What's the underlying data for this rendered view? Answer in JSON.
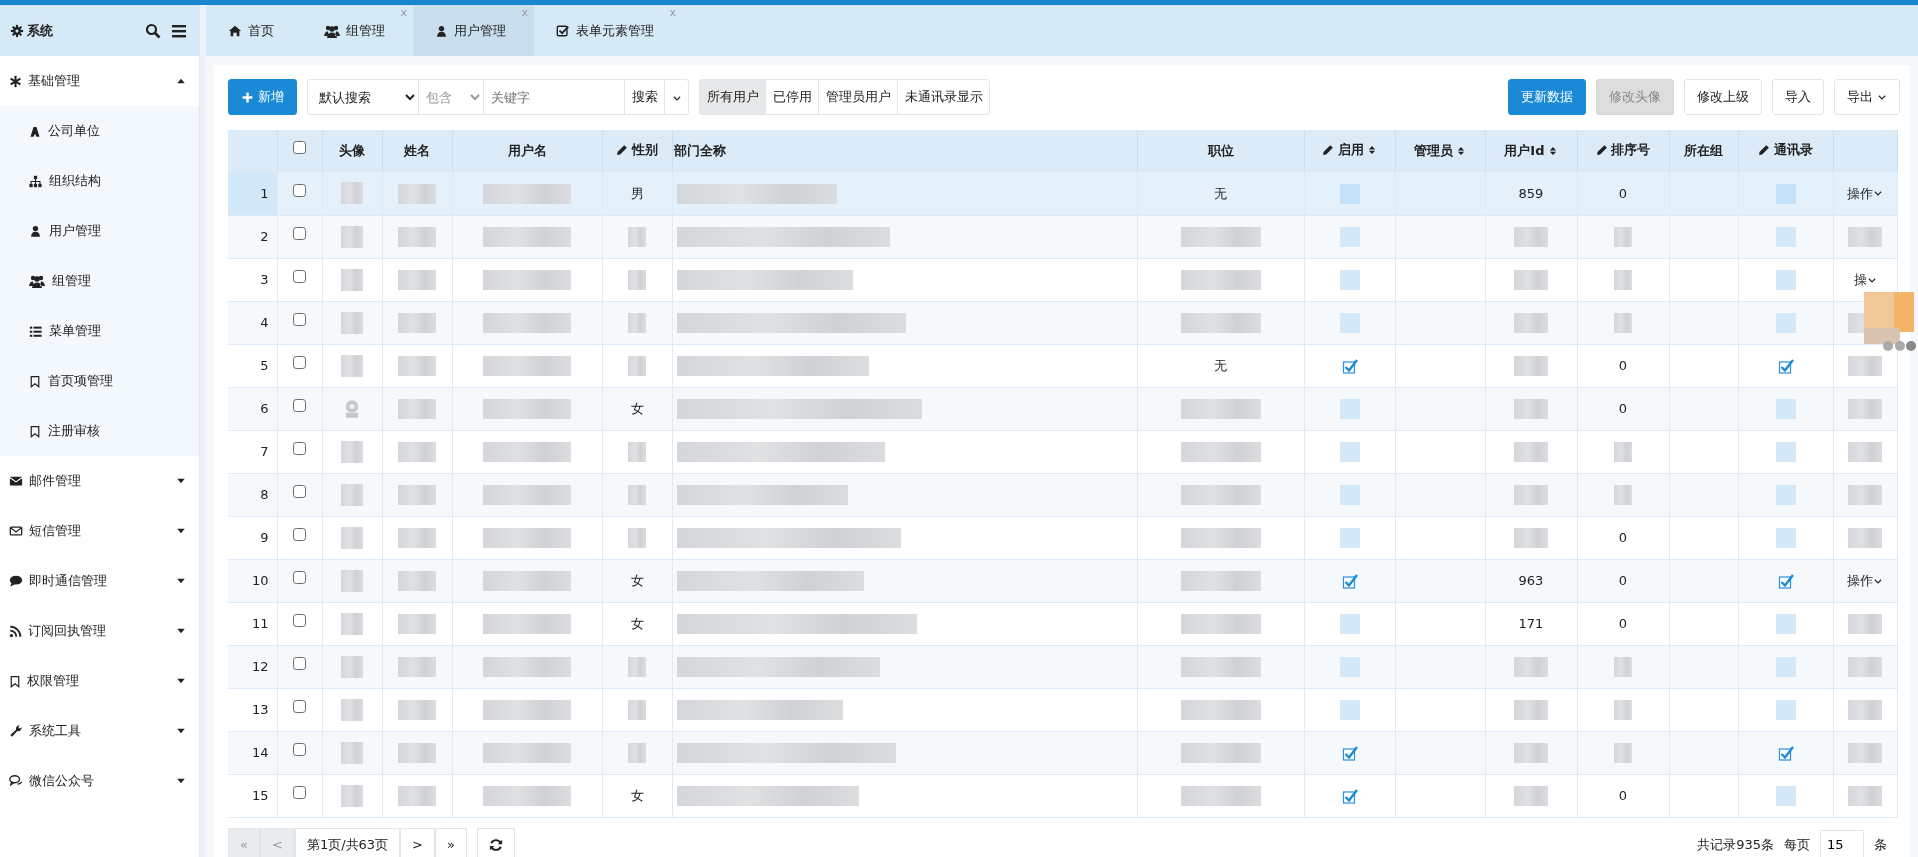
{
  "sidebar": {
    "title": "系统",
    "groups": [
      {
        "label": "基础管理",
        "expanded": true,
        "children": [
          {
            "label": "公司单位",
            "selected": false
          },
          {
            "label": "组织结构",
            "selected": false
          },
          {
            "label": "用户管理",
            "selected": false
          },
          {
            "label": "组管理",
            "selected": false
          },
          {
            "label": "菜单管理",
            "selected": false
          },
          {
            "label": "首页项管理",
            "selected": false
          },
          {
            "label": "注册审核",
            "selected": false
          }
        ]
      },
      {
        "label": "邮件管理",
        "expanded": false
      },
      {
        "label": "短信管理",
        "expanded": false
      },
      {
        "label": "即时通信管理",
        "expanded": false
      },
      {
        "label": "订阅回执管理",
        "expanded": false
      },
      {
        "label": "权限管理",
        "expanded": false
      },
      {
        "label": "系统工具",
        "expanded": false
      },
      {
        "label": "微信公众号",
        "expanded": false
      }
    ]
  },
  "tabs": [
    {
      "label": "首页",
      "selected": false
    },
    {
      "label": "组管理",
      "selected": false,
      "close": "x"
    },
    {
      "label": "用户管理",
      "selected": true,
      "close": "x"
    },
    {
      "label": "表单元素管理",
      "selected": false,
      "close": "x"
    }
  ],
  "toolbar": {
    "add": "新增",
    "search_mode": "默认搜索",
    "match": "包含",
    "keyword_placeholder": "关键字",
    "search": "搜索",
    "filters": [
      {
        "label": "所有用户",
        "selected": true
      },
      {
        "label": "已停用",
        "selected": false
      },
      {
        "label": "管理员用户",
        "selected": false
      },
      {
        "label": "未通讯录显示",
        "selected": false
      }
    ],
    "actions": [
      {
        "label": "更新数据",
        "kind": "primary",
        "disabled": false
      },
      {
        "label": "修改头像",
        "kind": "plain",
        "disabled": true
      },
      {
        "label": "修改上级",
        "kind": "plain",
        "disabled": false
      },
      {
        "label": "导入",
        "kind": "plain",
        "disabled": false
      },
      {
        "label": "导出",
        "kind": "dropdown",
        "disabled": false
      }
    ]
  },
  "table": {
    "all_checked": false,
    "columns": [
      {},
      {},
      {
        "label": "头像"
      },
      {
        "label": "姓名"
      },
      {
        "label": "用户名"
      },
      {
        "label": "性别",
        "editable": true,
        "sortable": false
      },
      {
        "label": "部门全称"
      },
      {
        "label": "职位"
      },
      {
        "label": "启用",
        "editable": true,
        "sortable": true
      },
      {
        "label": "管理员",
        "editable": false,
        "sortable": true
      },
      {
        "label": "用户Id",
        "editable": false,
        "sortable": true
      },
      {
        "label": "排序号",
        "editable": true,
        "sortable": false
      },
      {
        "label": "所在组"
      },
      {
        "label": "通讯录",
        "editable": true,
        "sortable": false
      },
      {}
    ],
    "rows": [
      {
        "no": "1",
        "selected": true,
        "checked": false,
        "avatar": {
          "kind": "blurred"
        },
        "name": null,
        "username": null,
        "gender": "男",
        "dept": null,
        "position": "无",
        "enabled": null,
        "userid": "859",
        "sort": "0",
        "contacts": null,
        "op": "操作"
      },
      {
        "no": "2",
        "selected": false,
        "checked": false,
        "avatar": {
          "kind": "blurred"
        },
        "name": null,
        "username": null,
        "gender": null,
        "dept": null,
        "position": null,
        "enabled": null,
        "userid": null,
        "sort": null,
        "contacts": null,
        "op": null
      },
      {
        "no": "3",
        "selected": false,
        "checked": false,
        "avatar": {
          "kind": "blurred"
        },
        "name": null,
        "username": null,
        "gender": null,
        "dept": null,
        "position": null,
        "enabled": null,
        "userid": null,
        "sort": null,
        "contacts": null,
        "op": "操"
      },
      {
        "no": "4",
        "selected": false,
        "checked": false,
        "avatar": {
          "kind": "blurred"
        },
        "name": null,
        "username": null,
        "gender": null,
        "dept": null,
        "position": null,
        "enabled": null,
        "userid": null,
        "sort": null,
        "contacts": null,
        "op": null
      },
      {
        "no": "5",
        "selected": false,
        "checked": false,
        "avatar": {
          "kind": "blurred"
        },
        "name": null,
        "username": null,
        "gender": null,
        "dept": null,
        "position": "无",
        "enabled": true,
        "userid": null,
        "sort": "0",
        "contacts": true,
        "op": null
      },
      {
        "no": "6",
        "selected": false,
        "checked": false,
        "avatar": {
          "kind": "default"
        },
        "name": null,
        "username": null,
        "gender": "女",
        "dept": null,
        "position": null,
        "enabled": null,
        "userid": null,
        "sort": "0",
        "contacts": null,
        "op": null
      },
      {
        "no": "7",
        "selected": false,
        "checked": false,
        "avatar": {
          "kind": "blurred"
        },
        "name": null,
        "username": null,
        "gender": null,
        "dept": null,
        "position": null,
        "enabled": null,
        "userid": null,
        "sort": null,
        "contacts": null,
        "op": null
      },
      {
        "no": "8",
        "selected": false,
        "checked": false,
        "avatar": {
          "kind": "blurred"
        },
        "name": null,
        "username": null,
        "gender": null,
        "dept": null,
        "position": null,
        "enabled": null,
        "userid": null,
        "sort": null,
        "contacts": null,
        "op": null
      },
      {
        "no": "9",
        "selected": false,
        "checked": false,
        "avatar": {
          "kind": "blurred"
        },
        "name": null,
        "username": null,
        "gender": null,
        "dept": null,
        "position": null,
        "enabled": null,
        "userid": null,
        "sort": "0",
        "contacts": null,
        "op": null
      },
      {
        "no": "10",
        "selected": false,
        "checked": false,
        "avatar": {
          "kind": "blurred"
        },
        "name": null,
        "username": null,
        "gender": "女",
        "dept": null,
        "position": null,
        "enabled": true,
        "userid": "963",
        "sort": "0",
        "contacts": true,
        "op": "操作"
      },
      {
        "no": "11",
        "selected": false,
        "checked": false,
        "avatar": {
          "kind": "blurred"
        },
        "name": null,
        "username": null,
        "gender": "女",
        "dept": null,
        "position": null,
        "enabled": null,
        "userid": "171",
        "sort": "0",
        "contacts": null,
        "op": null
      },
      {
        "no": "12",
        "selected": false,
        "checked": false,
        "avatar": {
          "kind": "blurred"
        },
        "name": null,
        "username": null,
        "gender": null,
        "dept": null,
        "position": null,
        "enabled": null,
        "userid": null,
        "sort": null,
        "contacts": null,
        "op": null
      },
      {
        "no": "13",
        "selected": false,
        "checked": false,
        "avatar": {
          "kind": "blurred"
        },
        "name": null,
        "username": null,
        "gender": null,
        "dept": null,
        "position": null,
        "enabled": null,
        "userid": null,
        "sort": null,
        "contacts": null,
        "op": null
      },
      {
        "no": "14",
        "selected": false,
        "checked": false,
        "avatar": {
          "kind": "blurred"
        },
        "name": null,
        "username": null,
        "gender": null,
        "dept": null,
        "position": null,
        "enabled": true,
        "userid": null,
        "sort": null,
        "contacts": true,
        "op": null
      },
      {
        "no": "15",
        "selected": false,
        "checked": false,
        "avatar": {
          "kind": "blurred"
        },
        "name": null,
        "username": null,
        "gender": "女",
        "dept": null,
        "position": null,
        "enabled": true,
        "userid": null,
        "sort": "0",
        "contacts": null,
        "op": null
      }
    ]
  },
  "pagination": {
    "first": "«",
    "prev": "<",
    "page_info": "第1页/共63页",
    "next": ">",
    "last": "»",
    "total": "共记录935条",
    "per_page_label": "每页",
    "per_page": "15",
    "unit": "条"
  }
}
